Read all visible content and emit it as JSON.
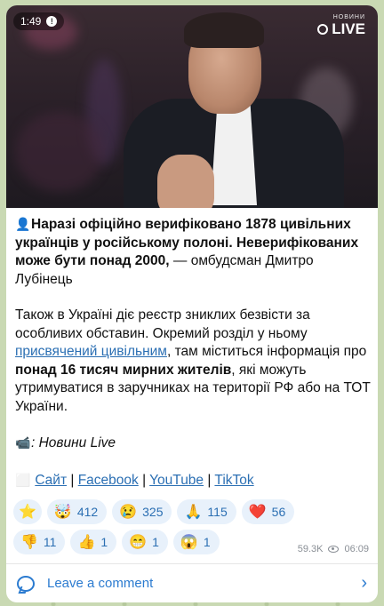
{
  "video": {
    "duration": "1:49",
    "logo_sub": "НОВИНИ",
    "logo_main": "LIVE"
  },
  "post": {
    "p1_icon": "👤",
    "p1_bold": "Наразі офіційно верифіковано 1878 цивільних українців у російському полоні. Неверифікованих може бути понад 2000,",
    "p1_rest": " — омбудсман Дмитро Лубінець",
    "p2_a": "Також в Україні діє реєстр зниклих безвісти за особливих обставин. Окремий розділ у ньому ",
    "p2_link": "присвячений цивільним",
    "p2_b": ", там міститься інформація про ",
    "p2_bold": "понад 16 тисяч мирних жителів",
    "p2_c": ", які можуть утримуватися в заручниках на території РФ або на ТОТ України.",
    "p3_icon": "📹",
    "p3_text": ": Новини Live",
    "links_icon": "⬜",
    "links": [
      "Сайт",
      "Facebook",
      "YouTube",
      "TikTok"
    ],
    "sep": " | "
  },
  "reactions": {
    "row1": [
      {
        "icon": "⭐",
        "count": ""
      },
      {
        "icon": "🤯",
        "count": "412"
      },
      {
        "icon": "😢",
        "count": "325"
      },
      {
        "icon": "🙏",
        "count": "115"
      },
      {
        "icon": "❤️",
        "count": "56"
      }
    ],
    "row2": [
      {
        "icon": "👎",
        "count": "11"
      },
      {
        "icon": "👍",
        "count": "1"
      },
      {
        "icon": "😁",
        "count": "1"
      },
      {
        "icon": "😱",
        "count": "1"
      }
    ]
  },
  "meta": {
    "views": "59.3K",
    "time": "06:09"
  },
  "comment": {
    "label": "Leave a comment"
  },
  "status": {
    "time": "1:49"
  }
}
